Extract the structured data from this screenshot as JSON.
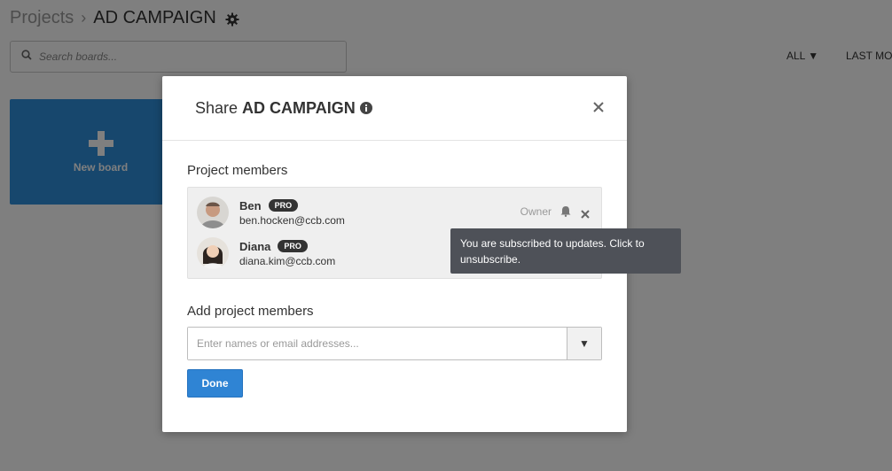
{
  "breadcrumb": {
    "root": "Projects",
    "separator": "›",
    "current": "AD CAMPAIGN"
  },
  "search": {
    "placeholder": "Search boards..."
  },
  "filters": {
    "all": "ALL ▼",
    "last_modified": "LAST MO"
  },
  "new_board": {
    "label": "New board"
  },
  "modal": {
    "title_prefix": "Share",
    "title_name": "AD CAMPAIGN",
    "members_label": "Project members",
    "members": [
      {
        "name": "Ben",
        "badge": "PRO",
        "email": "ben.hocken@ccb.com",
        "role": "Owner"
      },
      {
        "name": "Diana",
        "badge": "PRO",
        "email": "diana.kim@ccb.com"
      }
    ],
    "tooltip": "You are subscribed to updates. Click to unsubscribe.",
    "add_label": "Add project members",
    "add_placeholder": "Enter names or email addresses...",
    "dropdown_glyph": "▼",
    "done_label": "Done"
  },
  "colors": {
    "accent": "#2f84d4",
    "new_board_bg": "#2f8fdb",
    "tooltip_bg": "#4e5158",
    "overlay": "rgba(0,0,0,0.5)"
  }
}
